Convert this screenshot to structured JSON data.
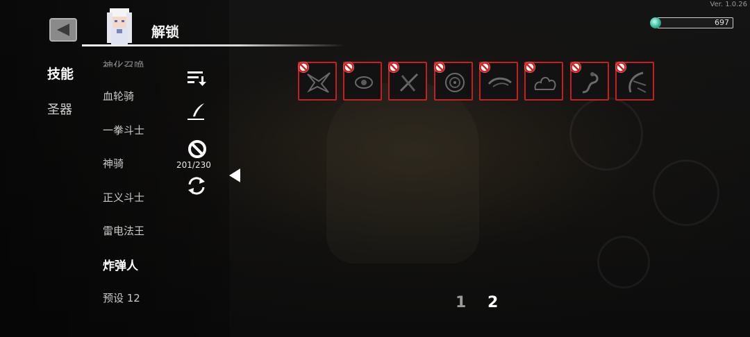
{
  "version": "Ver. 1.0.26",
  "currency": {
    "value": "697",
    "icon": "gem-icon"
  },
  "header": {
    "title": "解锁"
  },
  "categories": [
    {
      "label": "技能",
      "active": true
    },
    {
      "label": "圣器",
      "active": false
    }
  ],
  "class_list": [
    {
      "label": "神化召唤"
    },
    {
      "label": "血轮骑"
    },
    {
      "label": "一拳斗士"
    },
    {
      "label": "神骑"
    },
    {
      "label": "正义斗士"
    },
    {
      "label": "雷电法王"
    },
    {
      "label": "炸弹人"
    },
    {
      "label": "预设 12"
    }
  ],
  "tools": {
    "sort_icon": "sort-icon",
    "edit_icon": "quill-icon",
    "ban_icon": "ban-icon",
    "ban_counter": "201/230",
    "refresh_icon": "refresh-icon"
  },
  "skill_slots": [
    {
      "icon": "spiked-burst-skill-icon",
      "locked": true
    },
    {
      "icon": "eye-orb-skill-icon",
      "locked": true
    },
    {
      "icon": "crossed-blades-skill-icon",
      "locked": true
    },
    {
      "icon": "spiral-orb-skill-icon",
      "locked": true
    },
    {
      "icon": "wind-slash-skill-icon",
      "locked": true
    },
    {
      "icon": "smoke-cloud-skill-icon",
      "locked": true
    },
    {
      "icon": "serpent-skill-icon",
      "locked": true
    },
    {
      "icon": "claw-slash-skill-icon",
      "locked": true
    }
  ],
  "pagination": {
    "pages": [
      "1",
      "2"
    ],
    "current": "2"
  },
  "colors": {
    "slot_border": "#c61f1f",
    "lock_badge": "#d42020",
    "accent": "#ffffff"
  }
}
